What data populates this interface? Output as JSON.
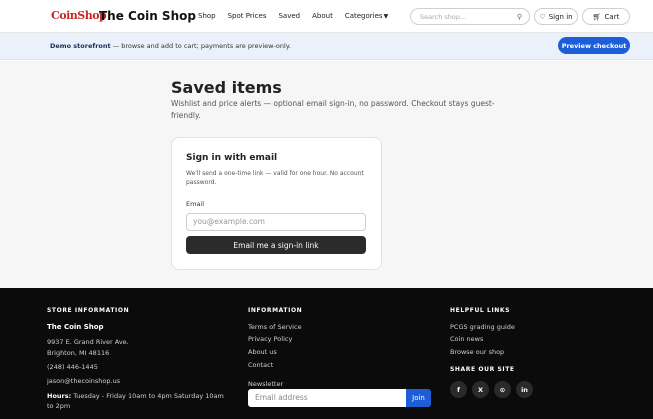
{
  "header": {
    "logo_text": "CoinShop",
    "shop_name": "The Coin Shop",
    "nav": [
      "Shop",
      "Spot Prices",
      "Saved",
      "About",
      "Categories"
    ],
    "search_placeholder": "Search shop...",
    "sign_in": "Sign in",
    "cart": "Cart"
  },
  "banner": {
    "bold": "Demo storefront",
    "text": " — browse and add to cart; payments are preview-only.",
    "preview_button": "Preview checkout"
  },
  "main": {
    "title": "Saved items",
    "subtitle": "Wishlist and price alerts — optional email sign-in, no password. Checkout stays guest-friendly.",
    "card": {
      "title": "Sign in with email",
      "description": "We'll send a one-time link — valid for one hour. No account password.",
      "email_label": "Email",
      "email_placeholder": "you@example.com",
      "button": "Email me a sign-in link"
    }
  },
  "footer": {
    "store_info": {
      "heading": "STORE INFORMATION",
      "name": "The Coin Shop",
      "address1": "9937 E. Grand River Ave.",
      "address2": "Brighton, MI 48116",
      "phone": "(248) 446-1445",
      "email": "jason@thecoinshop.us",
      "hours_label": "Hours:",
      "hours": " Tuesday - Friday 10am to 4pm Saturday 10am to 2pm"
    },
    "information": {
      "heading": "INFORMATION",
      "links": [
        "Terms of Service",
        "Privacy Policy",
        "About us",
        "Contact"
      ],
      "newsletter_label": "Newsletter",
      "newsletter_placeholder": "Email address",
      "join": "Join"
    },
    "helpful": {
      "heading": "HELPFUL LINKS",
      "links": [
        "PCGS grading guide",
        "Coin news",
        "Browse our shop"
      ],
      "share_heading": "SHARE OUR SITE",
      "social": [
        "f",
        "X",
        "⊙",
        "in"
      ]
    }
  },
  "colors": {
    "accent": "#1d5ed8",
    "banner_bg": "#eaf1fb",
    "footer_bg": "#0b0b0b",
    "logo_red": "#c62828"
  }
}
